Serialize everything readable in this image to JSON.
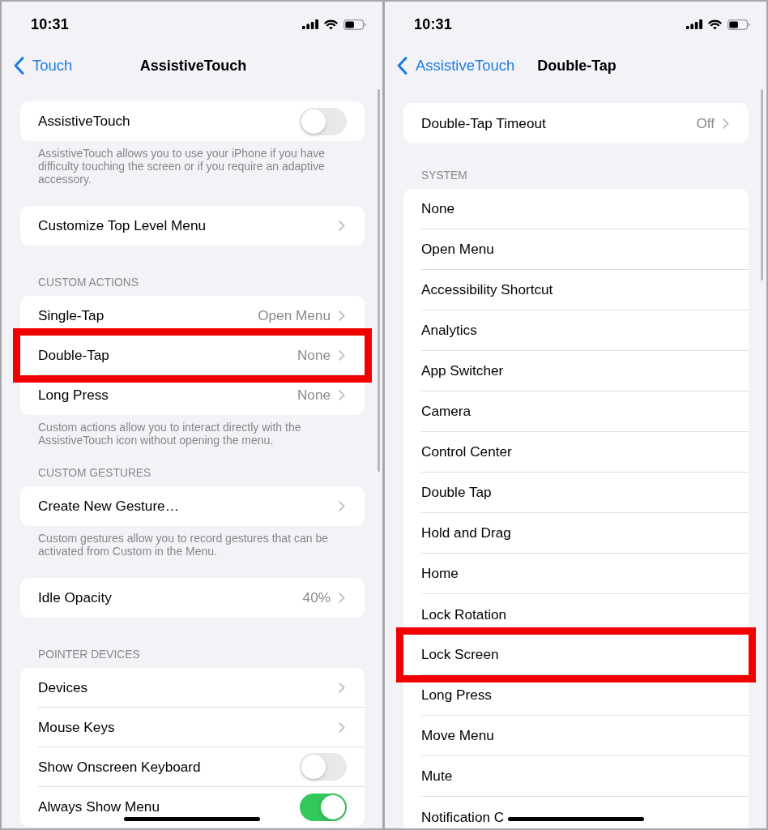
{
  "screens": [
    {
      "status_bar": {
        "time": "10:31"
      },
      "nav_bar": {
        "back": "Touch",
        "title": "AssistiveTouch"
      },
      "sections": [
        {
          "rows": [
            {
              "kind": "toggle",
              "label": "AssistiveTouch",
              "on": false,
              "highlighted": false
            }
          ],
          "footer": "AssistiveTouch allows you to use your iPhone if you have difficulty touching the screen or if you require an adaptive accessory."
        },
        {
          "rows": [
            {
              "kind": "link",
              "label": "Customize Top Level Menu",
              "highlighted": false
            }
          ]
        },
        {
          "header": "CUSTOM ACTIONS",
          "rows": [
            {
              "kind": "link",
              "label": "Single-Tap",
              "value": "Open Menu",
              "highlighted": false
            },
            {
              "kind": "link",
              "label": "Double-Tap",
              "value": "None",
              "highlighted": true
            },
            {
              "kind": "link",
              "label": "Long Press",
              "value": "None",
              "highlighted": false
            }
          ],
          "footer": "Custom actions allow you to interact directly with the AssistiveTouch icon without opening the menu."
        },
        {
          "header": "CUSTOM GESTURES",
          "rows": [
            {
              "kind": "link",
              "label": "Create New Gesture…",
              "highlighted": false
            }
          ],
          "footer": "Custom gestures allow you to record gestures that can be activated from Custom in the Menu."
        },
        {
          "rows": [
            {
              "kind": "link",
              "label": "Idle Opacity",
              "value": "40%",
              "highlighted": false
            }
          ]
        },
        {
          "header": "POINTER DEVICES",
          "rows": [
            {
              "kind": "link",
              "label": "Devices",
              "highlighted": false
            },
            {
              "kind": "link",
              "label": "Mouse Keys",
              "highlighted": false
            },
            {
              "kind": "toggle",
              "label": "Show Onscreen Keyboard",
              "on": false,
              "highlighted": false
            },
            {
              "kind": "toggle",
              "label": "Always Show Menu",
              "on": true,
              "highlighted": false
            }
          ]
        }
      ]
    },
    {
      "status_bar": {
        "time": "10:31"
      },
      "nav_bar": {
        "back": "AssistiveTouch",
        "title": "Double-Tap"
      },
      "sections": [
        {
          "rows": [
            {
              "kind": "link",
              "label": "Double-Tap Timeout",
              "value": "Off",
              "highlighted": false
            }
          ]
        },
        {
          "header": "SYSTEM",
          "rows": [
            {
              "kind": "option",
              "label": "None",
              "highlighted": false
            },
            {
              "kind": "option",
              "label": "Open Menu",
              "highlighted": false
            },
            {
              "kind": "option",
              "label": "Accessibility Shortcut",
              "highlighted": false
            },
            {
              "kind": "option",
              "label": "Analytics",
              "highlighted": false
            },
            {
              "kind": "option",
              "label": "App Switcher",
              "highlighted": false
            },
            {
              "kind": "option",
              "label": "Camera",
              "highlighted": false
            },
            {
              "kind": "option",
              "label": "Control Center",
              "highlighted": false
            },
            {
              "kind": "option",
              "label": "Double Tap",
              "highlighted": false
            },
            {
              "kind": "option",
              "label": "Hold and Drag",
              "highlighted": false
            },
            {
              "kind": "option",
              "label": "Home",
              "highlighted": false
            },
            {
              "kind": "option",
              "label": "Lock Rotation",
              "highlighted": false
            },
            {
              "kind": "option",
              "label": "Lock Screen",
              "highlighted": true
            },
            {
              "kind": "option",
              "label": "Long Press",
              "highlighted": false
            },
            {
              "kind": "option",
              "label": "Move Menu",
              "highlighted": false
            },
            {
              "kind": "option",
              "label": "Mute",
              "highlighted": false
            },
            {
              "kind": "option",
              "label": "Notification C",
              "highlighted": false
            }
          ]
        }
      ]
    }
  ]
}
